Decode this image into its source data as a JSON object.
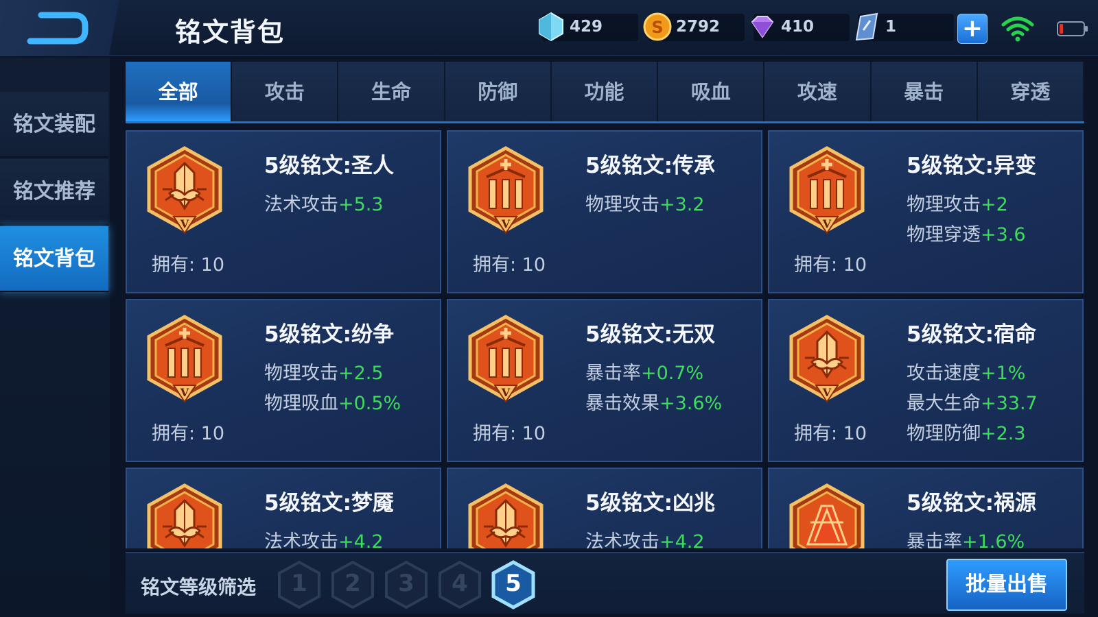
{
  "header": {
    "title": "铭文背包",
    "currencies": [
      {
        "name": "diamond-currency",
        "value": "429"
      },
      {
        "name": "gold-coin-currency",
        "value": "2792"
      },
      {
        "name": "gem-currency",
        "value": "410"
      },
      {
        "name": "crystal-currency",
        "value": "1"
      }
    ]
  },
  "sidebar": {
    "items": [
      {
        "label": "铭文装配"
      },
      {
        "label": "铭文推荐"
      },
      {
        "label": "铭文背包"
      }
    ],
    "active_index": 2
  },
  "tabs": [
    {
      "label": "全部"
    },
    {
      "label": "攻击"
    },
    {
      "label": "生命"
    },
    {
      "label": "防御"
    },
    {
      "label": "功能"
    },
    {
      "label": "吸血"
    },
    {
      "label": "攻速"
    },
    {
      "label": "暴击"
    },
    {
      "label": "穿透"
    }
  ],
  "active_tab": 0,
  "cards": [
    {
      "name": "5级铭文:圣人",
      "own": "拥有: 10",
      "icon": "crystal-emblem-icon",
      "stats": [
        {
          "label": "法术攻击",
          "bonus": "+5.3"
        }
      ]
    },
    {
      "name": "5级铭文:传承",
      "own": "拥有: 10",
      "icon": "pillar-emblem-icon",
      "stats": [
        {
          "label": "物理攻击",
          "bonus": "+3.2"
        }
      ]
    },
    {
      "name": "5级铭文:异变",
      "own": "拥有: 10",
      "icon": "pillar-emblem-icon",
      "stats": [
        {
          "label": "物理攻击",
          "bonus": "+2"
        },
        {
          "label": "物理穿透",
          "bonus": "+3.6"
        }
      ]
    },
    {
      "name": "5级铭文:纷争",
      "own": "拥有: 10",
      "icon": "pillar-emblem-icon",
      "stats": [
        {
          "label": "物理攻击",
          "bonus": "+2.5"
        },
        {
          "label": "物理吸血",
          "bonus": "+0.5%"
        }
      ]
    },
    {
      "name": "5级铭文:无双",
      "own": "拥有: 10",
      "icon": "pillar-emblem-icon",
      "stats": [
        {
          "label": "暴击率",
          "bonus": "+0.7%"
        },
        {
          "label": "暴击效果",
          "bonus": "+3.6%"
        }
      ]
    },
    {
      "name": "5级铭文:宿命",
      "own": "拥有: 10",
      "icon": "crystal-emblem-icon",
      "stats": [
        {
          "label": "攻击速度",
          "bonus": "+1%"
        },
        {
          "label": "最大生命",
          "bonus": "+33.7"
        },
        {
          "label": "物理防御",
          "bonus": "+2.3"
        }
      ]
    },
    {
      "name": "5级铭文:梦魇",
      "own": "",
      "icon": "crystal-emblem-icon",
      "stats": [
        {
          "label": "法术攻击",
          "bonus": "+4.2"
        }
      ]
    },
    {
      "name": "5级铭文:凶兆",
      "own": "",
      "icon": "crystal-emblem-icon",
      "stats": [
        {
          "label": "法术攻击",
          "bonus": "+4.2"
        }
      ]
    },
    {
      "name": "5级铭文:祸源",
      "own": "",
      "icon": "shard-emblem-icon",
      "stats": [
        {
          "label": "暴击率",
          "bonus": "+1.6%"
        }
      ]
    }
  ],
  "footer": {
    "filter_label": "铭文等级筛选",
    "levels": [
      "1",
      "2",
      "3",
      "4",
      "5"
    ],
    "active_level": "5",
    "batch_sell_label": "批量出售"
  },
  "colors": {
    "accent_blue": "#1f8fe0",
    "bonus_green": "#3ddc5a",
    "emblem_orange": "#e0521c",
    "emblem_gold": "#f2b24a"
  }
}
